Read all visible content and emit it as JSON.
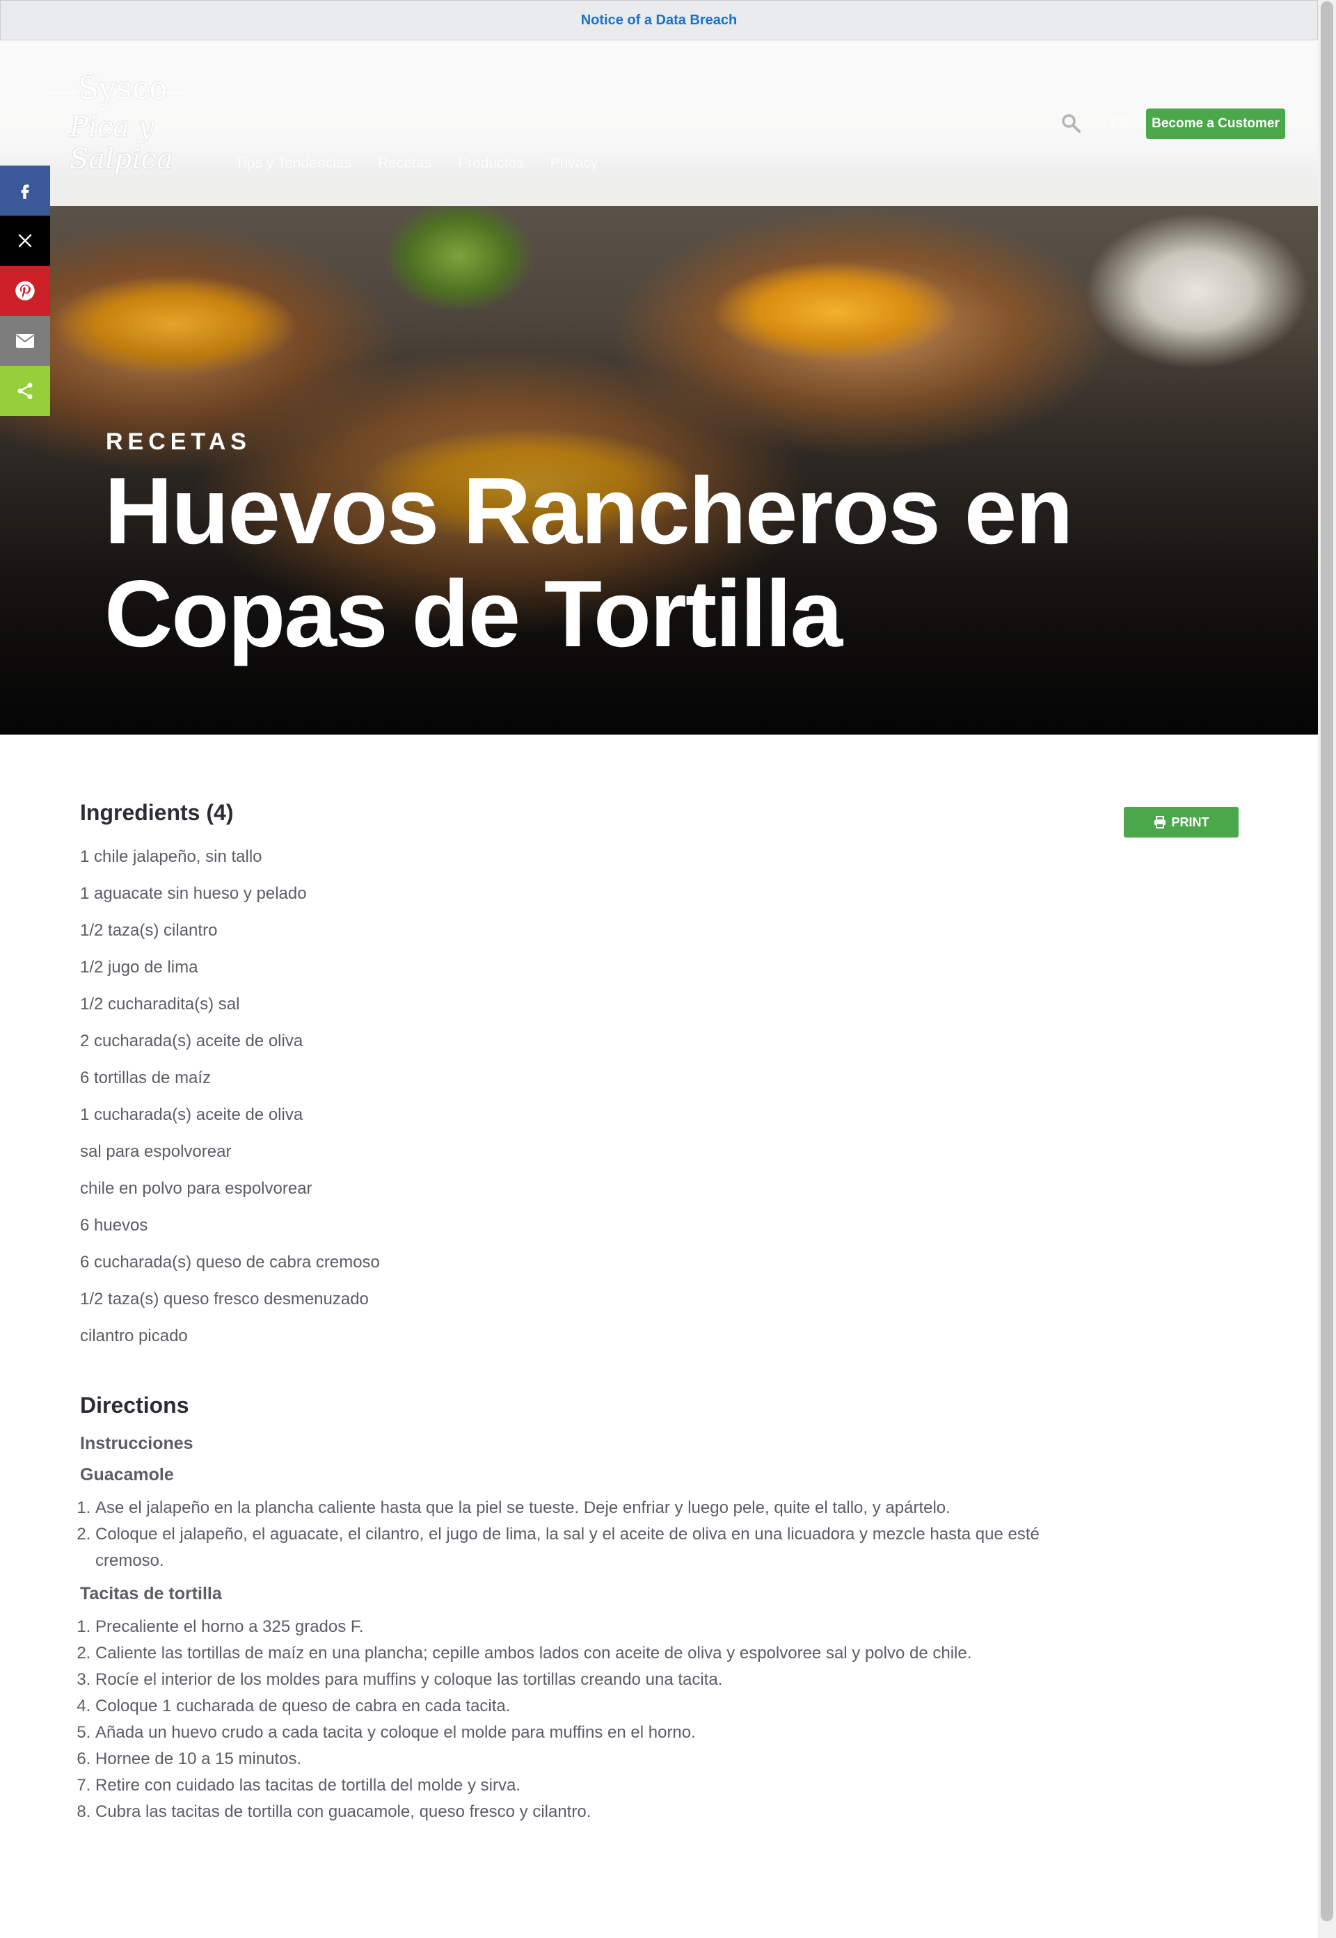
{
  "notice": {
    "text": "Notice of a Data Breach"
  },
  "header": {
    "logo_line1": "Sysco",
    "logo_line2": "Pica y Salpica",
    "nav": [
      "Tips y Tendencias",
      "Recetas",
      "Productos",
      "Privacy"
    ],
    "lang": "ES",
    "become_customer": "Become a Customer",
    "search_icon": "search-icon"
  },
  "hero": {
    "category": "RECETAS",
    "title": "Huevos Rancheros en Copas de Tortilla"
  },
  "share_icons": [
    "facebook-icon",
    "x-icon",
    "pinterest-icon",
    "email-icon",
    "share-icon"
  ],
  "colors": {
    "accent_green": "#4aa84a",
    "link_blue": "#1a73c8",
    "facebook": "#3b5998",
    "pinterest": "#cb2027",
    "share": "#95d03a"
  },
  "ingredients": {
    "heading": "Ingredients (4)",
    "print_label": "PRINT",
    "items": [
      "1 chile jalapeño, sin tallo",
      "1 aguacate sin hueso y pelado",
      "1/2 taza(s) cilantro",
      "1/2 jugo de lima",
      "1/2 cucharadita(s) sal",
      "2 cucharada(s) aceite de oliva",
      "6 tortillas de maíz",
      "1 cucharada(s) aceite de oliva",
      "sal para espolvorear",
      "chile en polvo para espolvorear",
      "6 huevos",
      "6 cucharada(s) queso de cabra cremoso",
      "1/2 taza(s) queso fresco desmenuzado",
      "cilantro picado"
    ]
  },
  "directions": {
    "heading": "Directions",
    "intro": "Instrucciones",
    "section1": "Guacamole",
    "steps1": [
      "Ase el jalapeño en la plancha caliente hasta que la piel se tueste.  Deje enfriar y luego pele, quite el tallo, y apártelo.",
      "Coloque el jalapeño, el aguacate, el cilantro, el jugo de lima, la sal y el aceite de oliva en una licuadora y mezcle hasta que esté cremoso."
    ],
    "section2": "Tacitas de tortilla",
    "steps2": [
      "Precaliente el horno a 325 grados F.",
      "Caliente las tortillas de maíz en una plancha; cepille ambos lados con aceite de oliva y espolvoree sal y polvo de chile.",
      "Rocíe el interior de los moldes para muffins y coloque las tortillas creando una tacita.",
      "Coloque 1 cucharada de queso de cabra en cada tacita.",
      "Añada un huevo crudo a cada tacita y coloque el molde para muffins en el horno.",
      "Hornee de 10 a 15 minutos.",
      "Retire con cuidado las tacitas de tortilla del molde y sirva.",
      "Cubra las tacitas de tortilla con guacamole, queso fresco y cilantro."
    ]
  }
}
